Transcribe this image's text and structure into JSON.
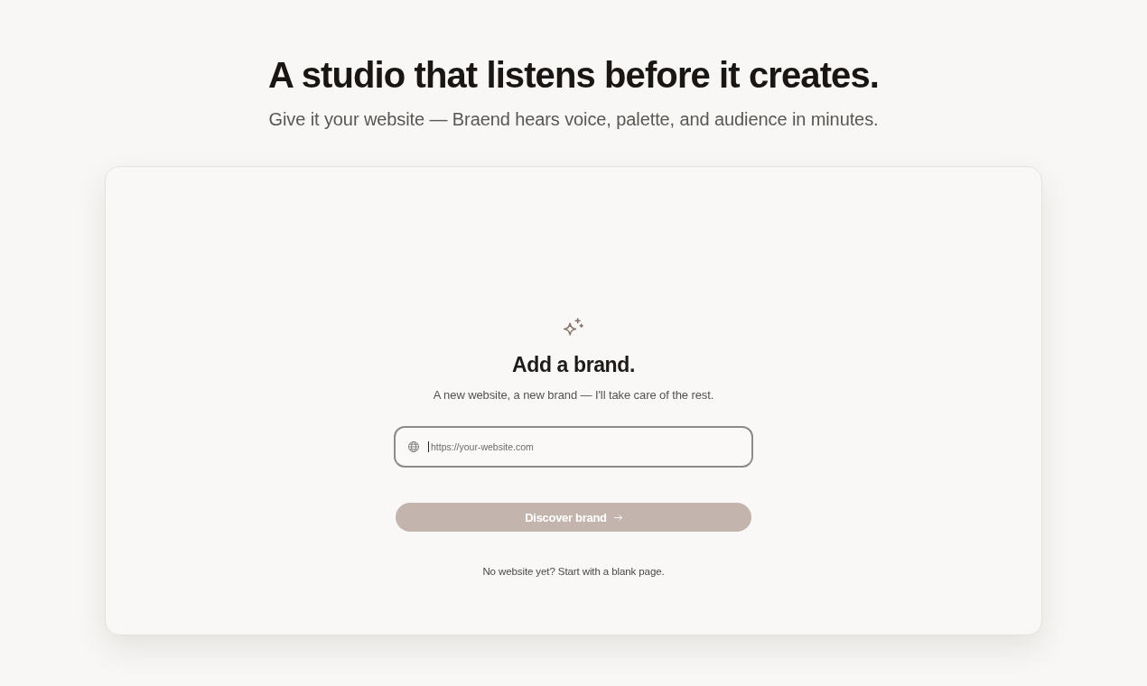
{
  "hero": {
    "title": "A studio that listens before it creates.",
    "subtitle": "Give it your website — Braend hears voice, palette, and audience in minutes."
  },
  "card": {
    "title": "Add a brand.",
    "subtitle": "A new website, a new brand — I'll take care of the rest.",
    "url_field": {
      "placeholder": "https://your-website.com",
      "focused": true
    },
    "submit_button": {
      "label": "Discover brand",
      "disabled": true
    },
    "footer_note": "No website yet? Start with a blank page."
  }
}
